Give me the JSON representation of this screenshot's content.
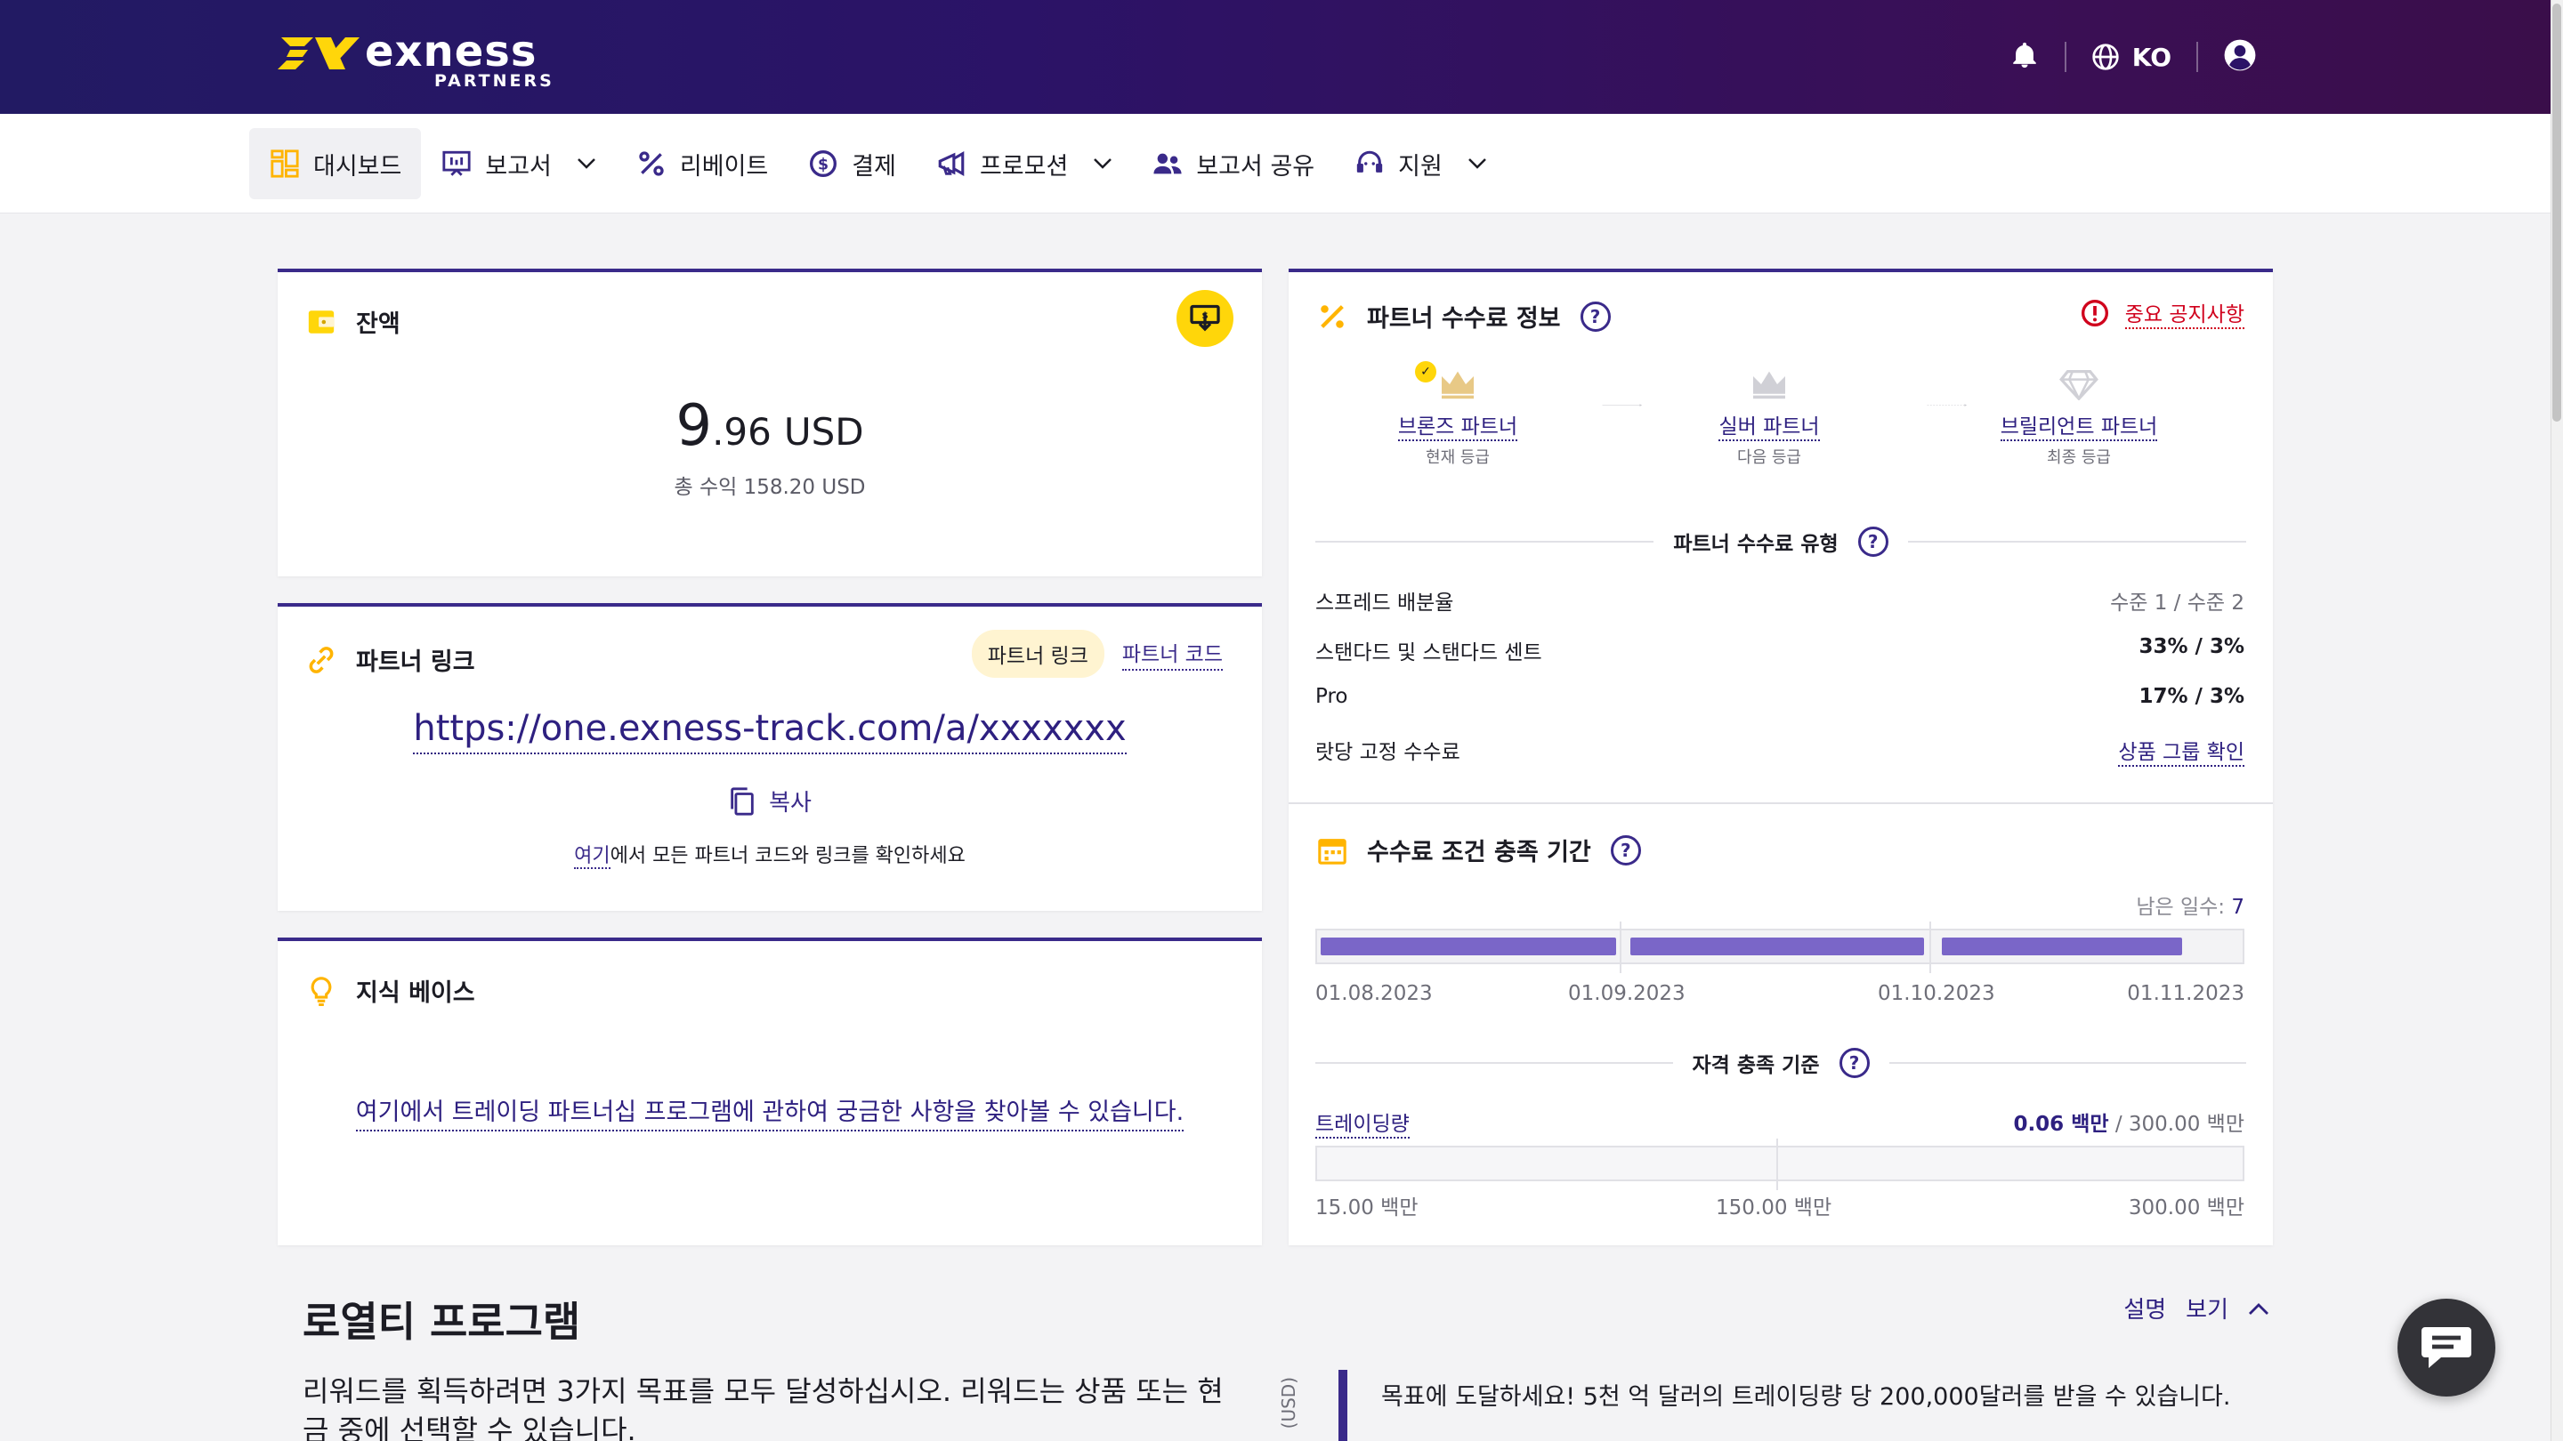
{
  "brand": {
    "name": "exness",
    "sub": "PARTNERS",
    "colors": {
      "accent": "#3a2a8a",
      "yellow": "#ffd60a",
      "alert": "#d0001c",
      "bar": "#7a66c8"
    }
  },
  "header": {
    "language": "KO",
    "icons": [
      "bell-icon",
      "globe-icon",
      "user-icon"
    ]
  },
  "nav": [
    {
      "label": "대시보드",
      "icon": "dashboard-icon",
      "dropdown": false,
      "active": true
    },
    {
      "label": "보고서",
      "icon": "report-icon",
      "dropdown": true
    },
    {
      "label": "리베이트",
      "icon": "percent-icon",
      "dropdown": false
    },
    {
      "label": "결제",
      "icon": "dollar-icon",
      "dropdown": false
    },
    {
      "label": "프로모션",
      "icon": "megaphone-icon",
      "dropdown": true
    },
    {
      "label": "보고서 공유",
      "icon": "people-icon",
      "dropdown": false
    },
    {
      "label": "지원",
      "icon": "headset-icon",
      "dropdown": true
    }
  ],
  "balance": {
    "title": "잔액",
    "int": "9",
    "frac": ".96",
    "currency": "USD",
    "total": "총 수익 158.20 USD"
  },
  "partner_link": {
    "title": "파트너 링크",
    "tab_link": "파트너 링크",
    "tab_code": "파트너 코드",
    "url": "https://one.exness-track.com/a/xxxxxxx",
    "copy": "복사",
    "hint_link": "여기",
    "hint_rest": "에서 모든 파트너 코드와 링크를 확인하세요"
  },
  "knowledge": {
    "title": "지식 베이스",
    "link": "여기에서 트레이딩 파트너십 프로그램에 관하여 궁금한 사항을 찾아볼 수 있습니다."
  },
  "commission": {
    "title": "파트너 수수료 정보",
    "notice": "중요 공지사항",
    "tiers": [
      {
        "name": "브론즈 파트너",
        "sub": "현재 등급"
      },
      {
        "name": "실버 파트너",
        "sub": "다음 등급"
      },
      {
        "name": "브릴리언트 파트너",
        "sub": "최종 등급"
      }
    ],
    "type_title": "파트너 수수료 유형",
    "rows": [
      {
        "label": "스프레드 배분율",
        "value": "수준 1 / 수준 2"
      },
      {
        "label": "스탠다드 및 스탠다드 센트",
        "value": "33% / 3%"
      },
      {
        "label": "Pro",
        "value": "17% / 3%"
      },
      {
        "label": "랏당 고정 수수료",
        "value": "상품 그룹 확인"
      }
    ]
  },
  "period": {
    "title": "수수료 조건 충족 기간",
    "days_left_label": "남은 일수:",
    "days_left": "7",
    "dates": [
      "01.08.2023",
      "01.09.2023",
      "01.10.2023",
      "01.11.2023"
    ],
    "criteria_title": "자격 충족 기준",
    "volume_label": "트레이딩량",
    "volume_current": "0.06 백만",
    "volume_target": " / 300.00 백만",
    "volume_ticks": [
      "15.00 백만",
      "150.00 백만",
      "300.00 백만"
    ]
  },
  "loyalty": {
    "title": "로열티 프로그램",
    "toggle_a": "설명",
    "toggle_b": "보기",
    "text": "리워드를 획득하려면 3가지 목표를 모두 달성하십시오. 리워드는 상품 또는 현금 중에 선택할 수 있습니다.",
    "usd": "(USD)",
    "goal": "목표에 도달하세요! 5천 억 달러의 트레이딩량 당 200,000달러를 받을 수 있습니다."
  }
}
